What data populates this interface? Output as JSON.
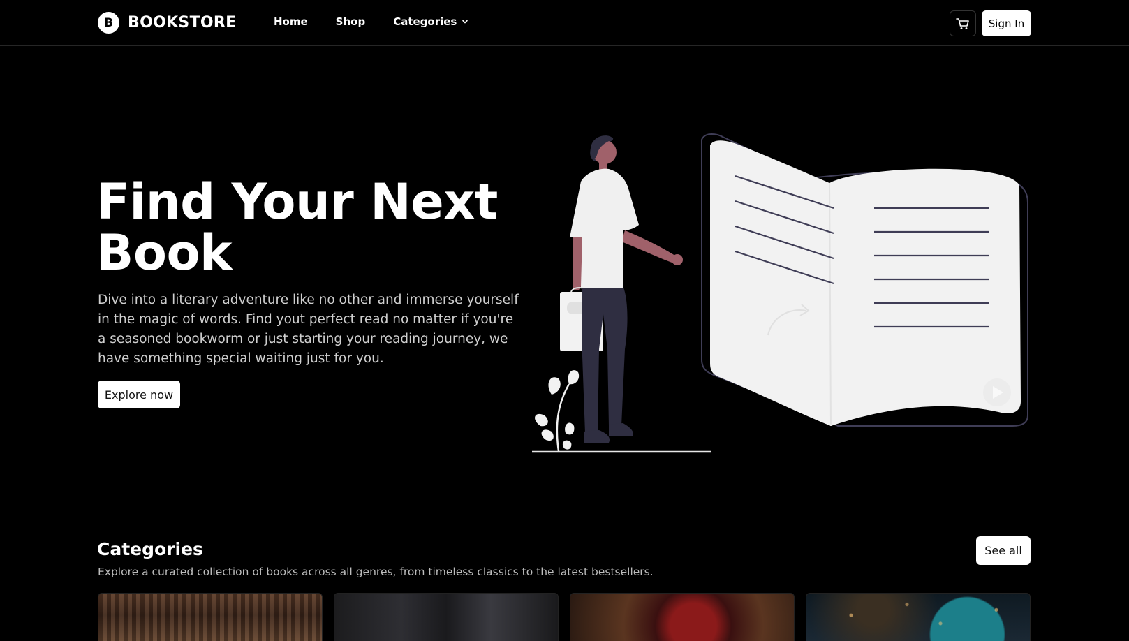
{
  "header": {
    "logo_letter": "B",
    "brand": "BOOKSTORE",
    "nav": {
      "home": "Home",
      "shop": "Shop",
      "categories": "Categories"
    },
    "sign_in": "Sign In"
  },
  "hero": {
    "title": "Find Your Next Book",
    "description": "Dive into a literary adventure like no other and immerse yourself in the magic of words. Find yout perfect read no matter if you're a seasoned bookworm or just starting your reading journey, we have something special waiting just for you.",
    "cta": "Explore now"
  },
  "categories": {
    "title": "Categories",
    "description": "Explore a curated collection of books across all genres, from timeless classics to the latest bestsellers.",
    "see_all": "See all"
  },
  "colors": {
    "background": "#000000",
    "accent": "#ffffff",
    "illustration_dark": "#2f2e41",
    "skin": "#a0616a"
  },
  "icons": {
    "cart": "cart-icon",
    "chevron": "chevron-down-icon"
  }
}
